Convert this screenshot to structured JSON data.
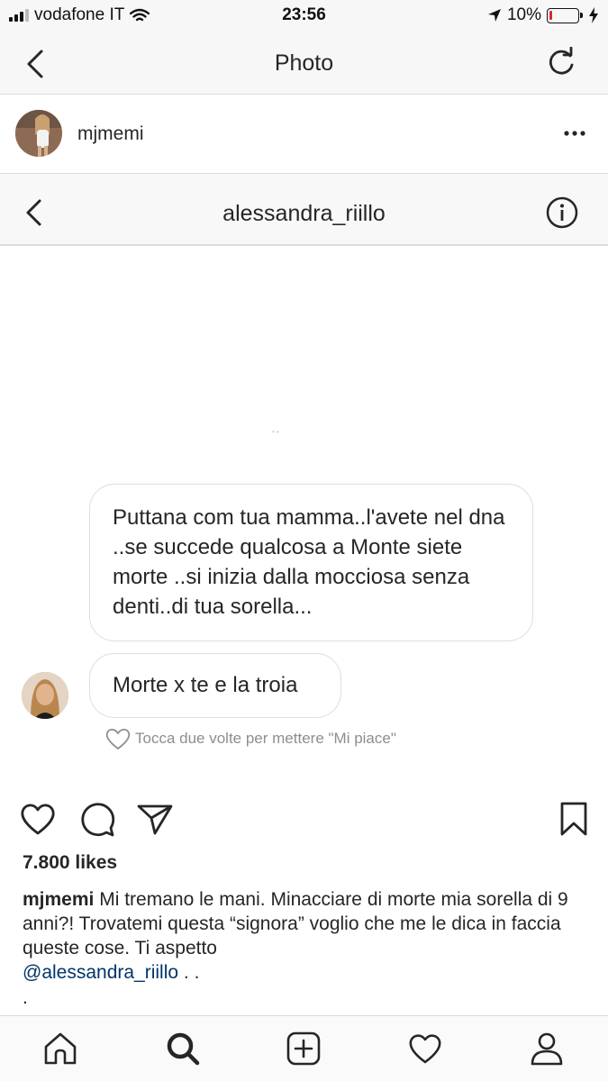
{
  "status_bar": {
    "carrier": "vodafone IT",
    "time": "23:56",
    "battery_percent": "10%",
    "battery_level": 0.1,
    "signal_bars_filled": 3,
    "signal_bars_total": 4,
    "icons": [
      "signal-icon",
      "wifi-icon",
      "location-arrow-icon",
      "battery-icon",
      "charging-bolt-icon"
    ]
  },
  "nav": {
    "title": "Photo",
    "back_icon": "chevron-left-icon",
    "refresh_icon": "refresh-icon"
  },
  "post": {
    "username": "mjmemi",
    "more_icon": "more-dots-icon"
  },
  "dm_screenshot": {
    "contact": "alessandra_riillo",
    "tiny_text": "ﾞﾞ",
    "messages": [
      {
        "text": "Puttana com tua mamma..l'avete  nel dna ..se succede qualcosa a Monte siete morte ..si inizia dalla mocciosa senza denti..di tua sorella..."
      },
      {
        "text": "Morte x te e la troia"
      }
    ],
    "like_hint": "Tocca due volte per mettere \"Mi piace\""
  },
  "actions": {
    "icons": [
      "heart-icon",
      "comment-icon",
      "share-icon",
      "bookmark-icon"
    ]
  },
  "likes": "7.800 likes",
  "caption": {
    "username": "mjmemi",
    "text": "Mi tremano le mani. Minacciare di morte mia sorella di 9 anni?! Trovatemi questa “signora” voglio che me le dica in faccia queste cose. Ti aspetto",
    "mention": "@alessandra_riillo",
    "suffix": ". .",
    "trailing": "."
  },
  "tab_bar": {
    "icons": [
      "home-icon",
      "search-icon",
      "add-post-icon",
      "activity-heart-icon",
      "profile-icon"
    ]
  },
  "colors": {
    "text": "#262626",
    "secondary": "#8e8e8e",
    "mention": "#003569",
    "battery_low": "#e0262b",
    "border": "#dbdbdb"
  }
}
